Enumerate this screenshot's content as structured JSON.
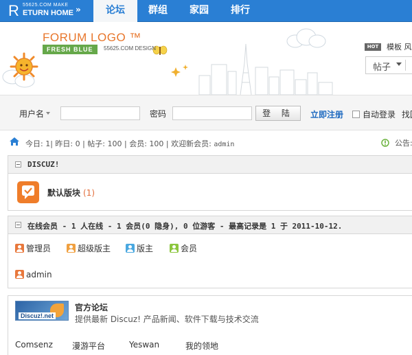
{
  "topnav": {
    "return_letter": "R",
    "return_small": "55625.COM MAKE",
    "return_home": "ETURN HOME",
    "return_arrows": "»",
    "tabs": [
      {
        "label": "论坛",
        "active": true
      },
      {
        "label": "群组",
        "active": false
      },
      {
        "label": "家园",
        "active": false
      },
      {
        "label": "排行",
        "active": false
      }
    ]
  },
  "header": {
    "logo_title": "FORUM LOGO ™",
    "logo_sub": "FRESH BLUE",
    "logo_design": "55625.COM DESIGN",
    "hot_badge": "HOT",
    "hot_links": "模板 风",
    "search_type": "帖子"
  },
  "login": {
    "username_label": "用户名",
    "password_label": "密码",
    "login_button": "登 陆",
    "register_link": "立即注册",
    "auto_login": "自动登录",
    "find_password": "找回"
  },
  "stats": {
    "text_prefix": "今日: 1| 昨日: 0 | 帖子: 100 | 会员: 100 | 欢迎新会员: ",
    "newest_member": "admin",
    "announcement": "公告:"
  },
  "category": {
    "title": "DISCUZ!",
    "forum_name": "默认版块",
    "forum_count": "(1)"
  },
  "online": {
    "title": "在线会员 - 1 人在线 - 1 会员(0 隐身), 0 位游客 - 最高记录是 1 于 2011-10-12.",
    "legend": [
      {
        "label": "管理员",
        "color": "#e8783c"
      },
      {
        "label": "超级版主",
        "color": "#f0a040"
      },
      {
        "label": "版主",
        "color": "#4aa8e0"
      },
      {
        "label": "会员",
        "color": "#8cc63e"
      }
    ],
    "users": [
      "admin"
    ]
  },
  "links": {
    "logo_text": "Discuz!.net",
    "title": "官方论坛",
    "description": "提供最新 Discuz! 产品新闻、软件下载与技术交流",
    "items": [
      "Comsenz",
      "漫游平台",
      "Yeswan",
      "我的领地"
    ]
  }
}
